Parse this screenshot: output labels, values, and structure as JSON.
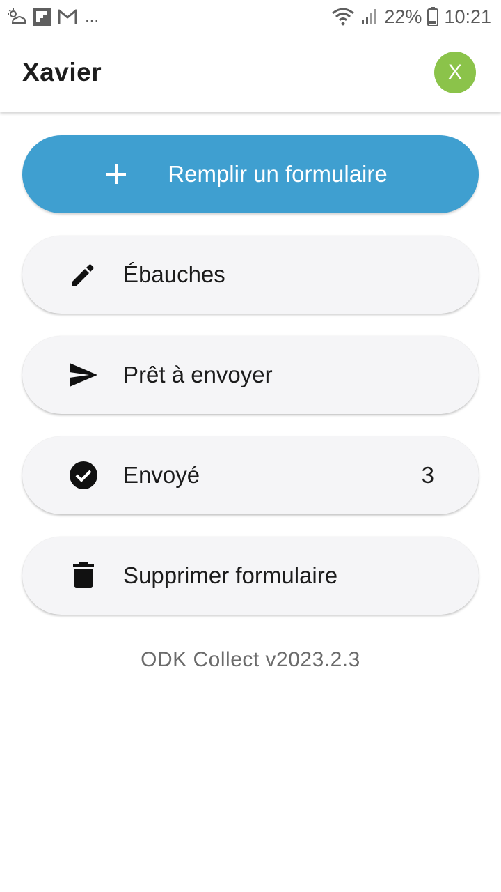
{
  "status_bar": {
    "dots": "...",
    "battery": "22%",
    "time": "10:21"
  },
  "app_bar": {
    "title": "Xavier",
    "avatar_letter": "X",
    "avatar_color": "#8bc34a"
  },
  "menu": {
    "fill_form": {
      "label": "Remplir un formulaire",
      "icon": "plus-icon"
    },
    "drafts": {
      "label": "Ébauches",
      "icon": "pencil-icon"
    },
    "ready_to_send": {
      "label": "Prêt à envoyer",
      "icon": "send-icon"
    },
    "sent": {
      "label": "Envoyé",
      "count": "3",
      "icon": "check-circle-icon"
    },
    "delete_form": {
      "label": "Supprimer formulaire",
      "icon": "trash-icon"
    }
  },
  "version": "ODK Collect v2023.2.3",
  "colors": {
    "primary_button": "#3f9fd0",
    "secondary_button": "#f5f5f7"
  }
}
